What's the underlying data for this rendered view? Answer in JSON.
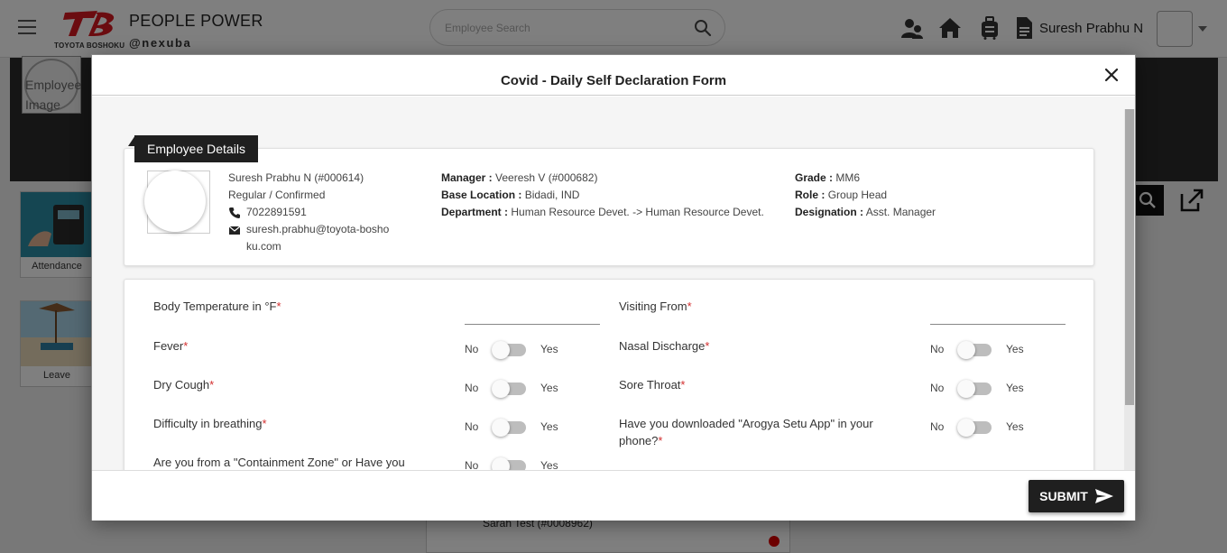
{
  "app": {
    "title": "PEOPLE POWER",
    "subtitle": "@nexuba",
    "logo_text": "TOYOTA BOSHOKU",
    "brand_color": "#d71920"
  },
  "header": {
    "search_placeholder": "Employee Search",
    "user_name": "Suresh Prabhu N",
    "icons": [
      "team-icon",
      "home-icon",
      "luggage-icon",
      "document-icon"
    ]
  },
  "background": {
    "banner_avatar_alt": "Employee Image",
    "tiles": [
      {
        "label": "Attendance",
        "icon": "attendance-icon"
      },
      {
        "label": "Leave",
        "icon": "leave-icon"
      }
    ],
    "card_text": "Sarah Test (#0008962)"
  },
  "modal": {
    "title": "Covid - Daily Self Declaration Form",
    "submit_label": "SUBMIT"
  },
  "employee": {
    "section_title": "Employee Details",
    "name_id": "Suresh Prabhu N (#000614)",
    "status": "Regular / Confirmed",
    "phone": "7022891591",
    "email": "suresh.prabhu@toyota-boshoku.com",
    "manager_label": "Manager :",
    "manager": "Veeresh V (#000682)",
    "base_location_label": "Base Location :",
    "base_location": "Bidadi, IND",
    "department_label": "Department :",
    "department": "Human Resource Devet. -> Human Resource Devet.",
    "grade_label": "Grade :",
    "grade": "MM6",
    "role_label": "Role :",
    "role": "Group Head",
    "designation_label": "Designation :",
    "designation": "Asst. Manager"
  },
  "form": {
    "no_label": "No",
    "yes_label": "Yes",
    "required_mark": "*",
    "body_temperature": {
      "label": "Body Temperature in °F",
      "value": ""
    },
    "visiting_from": {
      "label": "Visiting From",
      "value": ""
    },
    "fever": {
      "label": "Fever",
      "checked": false
    },
    "nasal_discharge": {
      "label": "Nasal Discharge",
      "checked": false
    },
    "dry_cough": {
      "label": "Dry Cough",
      "checked": false
    },
    "sore_throat": {
      "label": "Sore Throat",
      "checked": false
    },
    "difficulty_breathing": {
      "label": "Difficulty in breathing",
      "checked": false
    },
    "arogya_setu": {
      "label": "Have you downloaded \"Arogya Setu App\" in your phone?",
      "checked": false
    },
    "containment_zone": {
      "label": "Are you from a \"Containment Zone\" or Have you",
      "checked": false
    }
  }
}
